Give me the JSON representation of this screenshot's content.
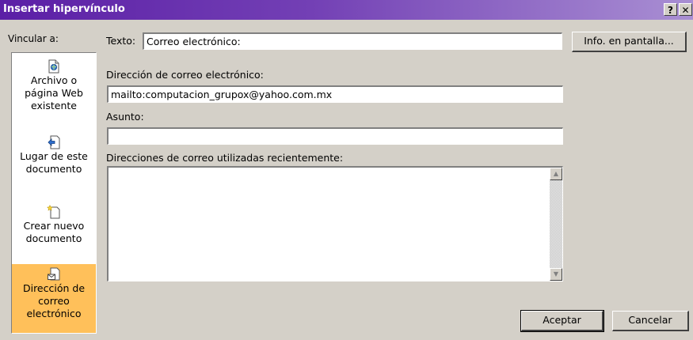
{
  "window": {
    "title": "Insertar hipervínculo",
    "help_label": "?",
    "close_label": "✕"
  },
  "link_to": {
    "label": "Vincular a:",
    "items": [
      {
        "lines": [
          "Archivo o",
          "página Web",
          "existente"
        ],
        "icon": "web-file-icon"
      },
      {
        "lines": [
          "Lugar de este",
          "documento"
        ],
        "icon": "place-in-document-icon"
      },
      {
        "lines": [
          "Crear nuevo",
          "documento"
        ],
        "icon": "new-document-icon"
      },
      {
        "lines": [
          "Dirección de",
          "correo",
          "electrónico"
        ],
        "icon": "email-address-icon",
        "selected": true
      }
    ]
  },
  "text_to_display": {
    "label": "Texto:",
    "value": "Correo electrónico:"
  },
  "screentip_button": "Info. en pantalla...",
  "email_address": {
    "label": "Dirección de correo electrónico:",
    "value": "mailto:computacion_grupox@yahoo.com.mx"
  },
  "subject": {
    "label": "Asunto:",
    "value": ""
  },
  "recent": {
    "label": "Direcciones de correo utilizadas recientemente:",
    "items": []
  },
  "buttons": {
    "ok": "Aceptar",
    "cancel": "Cancelar"
  },
  "colors": {
    "selected_item": "#ffc05a",
    "title_start": "#5b1fa6",
    "dialog_bg": "#d4d0c8"
  }
}
